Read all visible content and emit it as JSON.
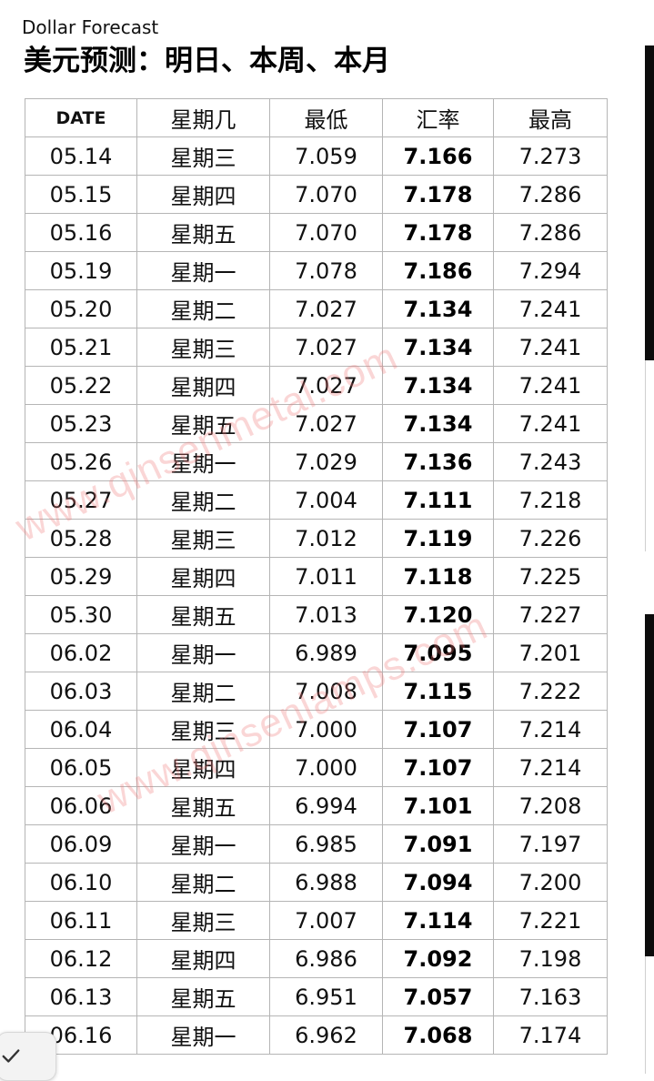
{
  "header": {
    "subtitle": "Dollar Forecast",
    "title": "美元预测：明日、本周、本月"
  },
  "table": {
    "columns": [
      "DATE",
      "星期几",
      "最低",
      "汇率",
      "最高"
    ],
    "rows": [
      {
        "date": "05.14",
        "weekday": "星期三",
        "low": "7.059",
        "rate": "7.166",
        "high": "7.273"
      },
      {
        "date": "05.15",
        "weekday": "星期四",
        "low": "7.070",
        "rate": "7.178",
        "high": "7.286"
      },
      {
        "date": "05.16",
        "weekday": "星期五",
        "low": "7.070",
        "rate": "7.178",
        "high": "7.286"
      },
      {
        "date": "05.19",
        "weekday": "星期一",
        "low": "7.078",
        "rate": "7.186",
        "high": "7.294"
      },
      {
        "date": "05.20",
        "weekday": "星期二",
        "low": "7.027",
        "rate": "7.134",
        "high": "7.241"
      },
      {
        "date": "05.21",
        "weekday": "星期三",
        "low": "7.027",
        "rate": "7.134",
        "high": "7.241"
      },
      {
        "date": "05.22",
        "weekday": "星期四",
        "low": "7.027",
        "rate": "7.134",
        "high": "7.241"
      },
      {
        "date": "05.23",
        "weekday": "星期五",
        "low": "7.027",
        "rate": "7.134",
        "high": "7.241"
      },
      {
        "date": "05.26",
        "weekday": "星期一",
        "low": "7.029",
        "rate": "7.136",
        "high": "7.243"
      },
      {
        "date": "05.27",
        "weekday": "星期二",
        "low": "7.004",
        "rate": "7.111",
        "high": "7.218"
      },
      {
        "date": "05.28",
        "weekday": "星期三",
        "low": "7.012",
        "rate": "7.119",
        "high": "7.226"
      },
      {
        "date": "05.29",
        "weekday": "星期四",
        "low": "7.011",
        "rate": "7.118",
        "high": "7.225"
      },
      {
        "date": "05.30",
        "weekday": "星期五",
        "low": "7.013",
        "rate": "7.120",
        "high": "7.227"
      },
      {
        "date": "06.02",
        "weekday": "星期一",
        "low": "6.989",
        "rate": "7.095",
        "high": "7.201"
      },
      {
        "date": "06.03",
        "weekday": "星期二",
        "low": "7.008",
        "rate": "7.115",
        "high": "7.222"
      },
      {
        "date": "06.04",
        "weekday": "星期三",
        "low": "7.000",
        "rate": "7.107",
        "high": "7.214"
      },
      {
        "date": "06.05",
        "weekday": "星期四",
        "low": "7.000",
        "rate": "7.107",
        "high": "7.214"
      },
      {
        "date": "06.06",
        "weekday": "星期五",
        "low": "6.994",
        "rate": "7.101",
        "high": "7.208"
      },
      {
        "date": "06.09",
        "weekday": "星期一",
        "low": "6.985",
        "rate": "7.091",
        "high": "7.197"
      },
      {
        "date": "06.10",
        "weekday": "星期二",
        "low": "6.988",
        "rate": "7.094",
        "high": "7.200"
      },
      {
        "date": "06.11",
        "weekday": "星期三",
        "low": "7.007",
        "rate": "7.114",
        "high": "7.221"
      },
      {
        "date": "06.12",
        "weekday": "星期四",
        "low": "6.986",
        "rate": "7.092",
        "high": "7.198"
      },
      {
        "date": "06.13",
        "weekday": "星期五",
        "low": "6.951",
        "rate": "7.057",
        "high": "7.163"
      },
      {
        "date": "06.16",
        "weekday": "星期一",
        "low": "6.962",
        "rate": "7.068",
        "high": "7.174"
      }
    ]
  },
  "watermarks": [
    "www.qinsenmetal.com",
    "www.qinsenlamps.com"
  ],
  "icons": {
    "check": "check-icon"
  },
  "colors": {
    "watermark": "#ee7676",
    "table_border": "#b5b5b5",
    "side_bar": "#0c0c0c"
  }
}
